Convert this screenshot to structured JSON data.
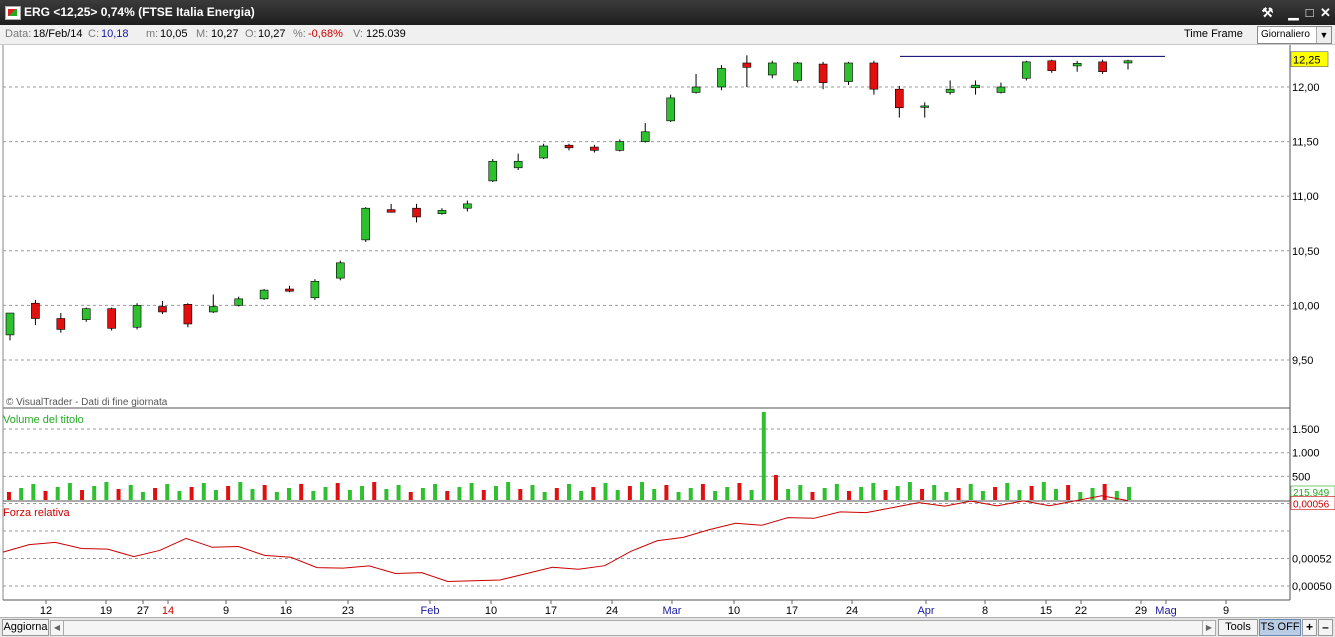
{
  "window": {
    "title": "ERG <12,25> 0,74%  (FTSE Italia Energia)",
    "buttons": {
      "tools": "⚒",
      "minimize": "▁",
      "maximize": "□",
      "close": "✕"
    }
  },
  "info": {
    "data_label": "Data:",
    "data_value": "18/Feb/14",
    "c_label": "C:",
    "c_value": "10,18",
    "m_label": "m:",
    "m_value": "10,05",
    "M_label": "M:",
    "M_value": "10,27",
    "o_label": "O:",
    "o_value": "10,27",
    "pct_label": "%:",
    "pct_value": "-0,68%",
    "v_label": "V:",
    "v_value": "125.039",
    "timeframe_label": "Time Frame",
    "timeframe_value": "Giornaliero"
  },
  "watermark": "© VisualTrader - Dati di fine giornata",
  "bottom": {
    "aggiorna": "Aggiorna",
    "tools": "Tools",
    "ts": "TS OFF",
    "zoom_in": "+",
    "zoom_out": "–"
  },
  "colors": {
    "up": "#2ec02e",
    "down": "#e01010",
    "grid": "#9a9a9a",
    "rs_line": "#cc0000",
    "volume_label": "#22aa22",
    "rs_label": "#cc0000",
    "resistance": "#00006a",
    "last_price_bg": "#ffff00"
  },
  "chart_data": [
    {
      "type": "candlestick",
      "title": "",
      "y_ticks": [
        "12,00",
        "11,50",
        "11,00",
        "10,50",
        "10,00",
        "9,50"
      ],
      "ylim": [
        9.3,
        12.65
      ],
      "last_price_label": "12,25",
      "x_ticks": [
        {
          "label": "12",
          "color": "#000"
        },
        {
          "label": "19",
          "color": "#000"
        },
        {
          "label": "27",
          "color": "#000"
        },
        {
          "label": "14",
          "color": "#cc0000"
        },
        {
          "label": "9",
          "color": "#000"
        },
        {
          "label": "16",
          "color": "#000"
        },
        {
          "label": "23",
          "color": "#000"
        },
        {
          "label": "Feb",
          "color": "#1a1aa0"
        },
        {
          "label": "10",
          "color": "#000"
        },
        {
          "label": "17",
          "color": "#000"
        },
        {
          "label": "24",
          "color": "#000"
        },
        {
          "label": "Mar",
          "color": "#1a1aa0"
        },
        {
          "label": "10",
          "color": "#000"
        },
        {
          "label": "17",
          "color": "#000"
        },
        {
          "label": "24",
          "color": "#000"
        },
        {
          "label": "Apr",
          "color": "#1a1aa0"
        },
        {
          "label": "8",
          "color": "#000"
        },
        {
          "label": "15",
          "color": "#000"
        },
        {
          "label": "22",
          "color": "#000"
        },
        {
          "label": "29",
          "color": "#000"
        },
        {
          "label": "Mag",
          "color": "#1a1aa0"
        },
        {
          "label": "9",
          "color": "#000"
        }
      ],
      "resistance_level": 12.28,
      "candles": [
        [
          9.73,
          9.93,
          9.68,
          9.92
        ],
        [
          10.02,
          9.88,
          9.82,
          10.05
        ],
        [
          9.88,
          9.78,
          9.75,
          9.93
        ],
        [
          9.87,
          9.97,
          9.85,
          9.98
        ],
        [
          9.97,
          9.79,
          9.77,
          9.98
        ],
        [
          9.8,
          10.0,
          9.78,
          10.02
        ],
        [
          9.99,
          9.94,
          9.92,
          10.04
        ],
        [
          10.01,
          9.83,
          9.8,
          10.02
        ],
        [
          9.94,
          9.99,
          9.93,
          10.1
        ],
        [
          10.0,
          10.06,
          9.99,
          10.08
        ],
        [
          10.06,
          10.14,
          10.05,
          10.15
        ],
        [
          10.15,
          10.13,
          10.12,
          10.18
        ],
        [
          10.07,
          10.22,
          10.05,
          10.24
        ],
        [
          10.25,
          10.39,
          10.23,
          10.41
        ],
        [
          10.6,
          10.89,
          10.58,
          10.9
        ],
        [
          10.87,
          10.86,
          10.85,
          10.93
        ],
        [
          10.89,
          10.81,
          10.76,
          10.93
        ],
        [
          10.84,
          10.87,
          10.83,
          10.89
        ],
        [
          10.89,
          10.93,
          10.86,
          10.96
        ],
        [
          11.14,
          11.32,
          11.13,
          11.34
        ],
        [
          11.26,
          11.32,
          11.24,
          11.39
        ],
        [
          11.35,
          11.46,
          11.34,
          11.48
        ],
        [
          11.46,
          11.45,
          11.42,
          11.48
        ],
        [
          11.45,
          11.42,
          11.4,
          11.47
        ],
        [
          11.42,
          11.5,
          11.41,
          11.52
        ],
        [
          11.5,
          11.59,
          11.49,
          11.67
        ],
        [
          11.69,
          11.9,
          11.68,
          11.93
        ],
        [
          11.95,
          12.0,
          11.94,
          12.12
        ],
        [
          12.0,
          12.17,
          11.97,
          12.2
        ],
        [
          12.22,
          12.18,
          12.0,
          12.29
        ],
        [
          12.11,
          12.22,
          12.08,
          12.24
        ],
        [
          12.06,
          12.22,
          12.04,
          12.23
        ],
        [
          12.21,
          12.04,
          11.98,
          12.23
        ],
        [
          12.05,
          12.22,
          12.02,
          12.23
        ],
        [
          12.22,
          11.98,
          11.93,
          12.24
        ],
        [
          11.98,
          11.81,
          11.72,
          12.01
        ],
        [
          11.82,
          11.82,
          11.72,
          11.86
        ],
        [
          11.95,
          11.98,
          11.93,
          12.06
        ],
        [
          12.0,
          12.01,
          11.93,
          12.06
        ],
        [
          11.95,
          12.0,
          11.94,
          12.04
        ],
        [
          12.08,
          12.23,
          12.06,
          12.24
        ],
        [
          12.24,
          12.15,
          12.13,
          12.25
        ],
        [
          12.2,
          12.21,
          12.14,
          12.24
        ],
        [
          12.23,
          12.14,
          12.12,
          12.25
        ],
        [
          12.22,
          12.24,
          12.16,
          12.25
        ]
      ]
    },
    {
      "type": "bar",
      "title": "Volume del titolo",
      "y_ticks": [
        "1.500",
        "1.000",
        "500"
      ],
      "last_value_label": "215.949",
      "ylim": [
        0,
        1860
      ]
    },
    {
      "type": "line",
      "title": "Forza relativa",
      "y_ticks": [
        "0,00052",
        "0,00050"
      ],
      "last_value_label": "0,00056",
      "series": [
        {
          "values": [
            0.000522,
            0.000531,
            0.00053,
            0.000529,
            0.000526,
            0.000524,
            0.000526,
            0.000532,
            0.000529,
            0.000527,
            0.000524,
            0.00052,
            0.000516,
            0.000513,
            0.000512,
            0.00051,
            0.000508,
            0.000505,
            0.000503,
            0.000507,
            0.000509,
            0.000511,
            0.000513,
            0.000513,
            0.000527,
            0.000532,
            0.000538,
            0.000541,
            0.000543,
            0.000545,
            0.000548,
            0.000551,
            0.000553,
            0.000556,
            0.000557,
            0.000558,
            0.000559,
            0.00056,
            0.00056,
            0.000561,
            0.000561,
            0.000562,
            0.000563,
            0.000563
          ]
        }
      ]
    }
  ]
}
